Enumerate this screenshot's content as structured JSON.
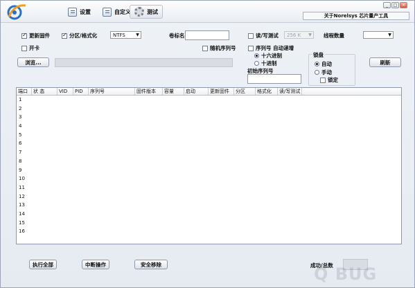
{
  "window": {
    "app_title": "关于Norelsys 芯片量产工具",
    "controls": [
      "_",
      "□",
      "×"
    ]
  },
  "tabs": [
    {
      "label": "设置",
      "icon": "settings-doc-icon"
    },
    {
      "label": "自定义",
      "icon": "custom-doc-icon"
    },
    {
      "label": "测试",
      "icon": "gear-icon",
      "active": true
    }
  ],
  "options": {
    "update_firmware": {
      "label": "更新固件",
      "checked": true
    },
    "partition_format": {
      "label": "分区/格式化",
      "checked": true
    },
    "fs_select": {
      "value": "NTFS"
    },
    "volume_label": {
      "label": "卷标名",
      "value": ""
    },
    "rw_test": {
      "label": "读/写测试",
      "checked": false
    },
    "rw_size": {
      "value": "256 K"
    },
    "thread_count": {
      "label": "线程数量",
      "value": ""
    },
    "open_card": {
      "label": "开卡",
      "checked": false
    },
    "random_serial": {
      "label": "随机序列号",
      "checked": false
    },
    "serial_auto_inc": {
      "label": "序列号 自动递增",
      "checked": false
    },
    "hex": {
      "label": "十六进制",
      "checked": true
    },
    "dec": {
      "label": "十进制",
      "checked": false
    },
    "initial_serial": {
      "label": "初始序列号",
      "value": ""
    },
    "lock_disk": {
      "title": "锁盘",
      "auto": {
        "label": "自动",
        "checked": true
      },
      "manual": {
        "label": "手动",
        "checked": false
      },
      "lock": {
        "label": "锁定",
        "checked": false
      }
    }
  },
  "buttons": {
    "browse": "浏览...",
    "refresh": "刷新",
    "run_all": "执行全部",
    "interrupt": "中断操作",
    "safe_remove": "安全移除"
  },
  "table": {
    "columns": [
      "端口",
      "状  态",
      "VID",
      "PID",
      "序列号",
      "固件版本",
      "容量",
      "启动",
      "更新固件",
      "分区",
      "格式化",
      "读/写测试"
    ],
    "rows": [
      "1",
      "2",
      "3",
      "4",
      "5",
      "6",
      "7",
      "8",
      "9",
      "10",
      "11",
      "12",
      "13",
      "14",
      "15",
      "16"
    ]
  },
  "footer": {
    "success_total_label": "成功/总数",
    "success_total_value": ""
  },
  "watermark": "Q BUG"
}
